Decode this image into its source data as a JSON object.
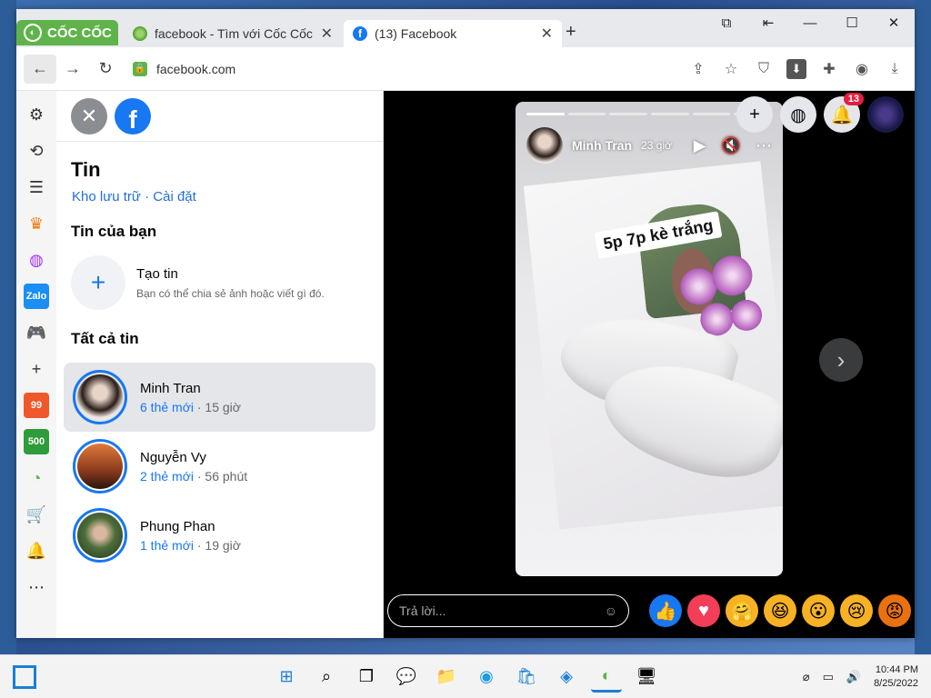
{
  "browser": {
    "brand": "CỐC CỐC",
    "tabs": [
      {
        "title": "facebook - Tìm với Cốc Cốc",
        "favicon": "coccoc-icon"
      },
      {
        "title": "(13) Facebook",
        "favicon": "facebook-icon"
      }
    ],
    "url": "facebook.com"
  },
  "stories_panel": {
    "title": "Tin",
    "links": "Kho lưu trữ · Cài đặt",
    "your_stories_heading": "Tin của bạn",
    "create": {
      "title": "Tạo tin",
      "subtitle": "Bạn có thể chia sẻ ảnh hoặc viết gì đó."
    },
    "all_stories_heading": "Tất cả tin",
    "stories": [
      {
        "name": "Minh Tran",
        "new_count": "6 thẻ mới",
        "time": "· 15 giờ"
      },
      {
        "name": "Nguyễn Vy",
        "new_count": "2 thẻ mới",
        "time": "· 56 phút"
      },
      {
        "name": "Phung Phan",
        "new_count": "1 thẻ mới",
        "time": "· 19 giờ"
      }
    ]
  },
  "viewer": {
    "author": "Minh Tran",
    "time": "23 giờ",
    "sticker_text": "5p 7p kè trắng",
    "notification_count": "13",
    "reply_placeholder": "Trả lời...",
    "progress_total": 6,
    "progress_done": 1
  },
  "taskbar": {
    "time": "10:44 PM",
    "date": "8/25/2022"
  },
  "colors": {
    "accent": "#1877f2",
    "brand_green": "#5fb34a"
  }
}
